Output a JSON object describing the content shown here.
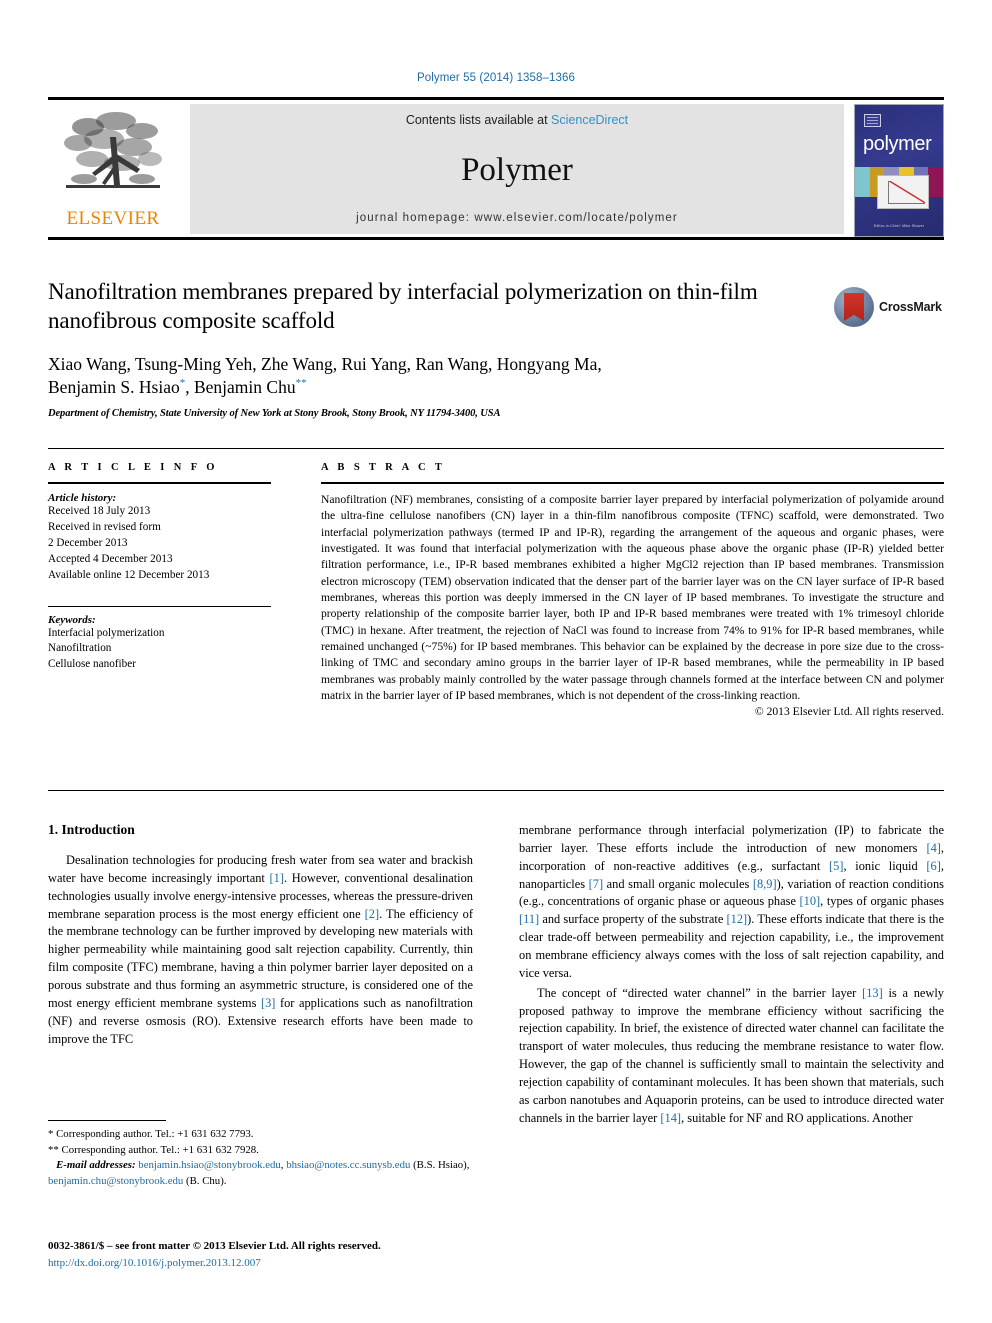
{
  "running_head": "Polymer 55 (2014) 1358–1366",
  "masthead": {
    "publisher_logo_label": "ELSEVIER",
    "contents_prefix": "Contents lists available at ",
    "contents_link": "ScienceDirect",
    "journal_name": "Polymer",
    "homepage": "journal homepage: www.elsevier.com/locate/polymer",
    "cover": {
      "title": "polymer",
      "footer": "Editor-in-Chief: Mike Shaver"
    }
  },
  "article": {
    "title": "Nanofiltration membranes prepared by interfacial polymerization on thin-film nanofibrous composite scaffold",
    "authors_line1": "Xiao Wang, Tsung-Ming Yeh, Zhe Wang, Rui Yang, Ran Wang, Hongyang Ma,",
    "authors_line2_a": "Benjamin S. Hsiao",
    "authors_line2_mark1": "*",
    "authors_line2_b": ", Benjamin Chu",
    "authors_line2_mark2": "**",
    "affiliation": "Department of Chemistry, State University of New York at Stony Brook, Stony Brook, NY 11794-3400, USA",
    "crossmark_label": "CrossMark"
  },
  "article_info": {
    "heading": "A R T I C L E   I N F O",
    "history_label": "Article history:",
    "history": [
      "Received 18 July 2013",
      "Received in revised form",
      "2 December 2013",
      "Accepted 4 December 2013",
      "Available online 12 December 2013"
    ],
    "keywords_label": "Keywords:",
    "keywords": [
      "Interfacial polymerization",
      "Nanofiltration",
      "Cellulose nanofiber"
    ]
  },
  "abstract": {
    "heading": "A B S T R A C T",
    "text": "Nanofiltration (NF) membranes, consisting of a composite barrier layer prepared by interfacial polymerization of polyamide around the ultra-fine cellulose nanofibers (CN) layer in a thin-film nanofibrous composite (TFNC) scaffold, were demonstrated. Two interfacial polymerization pathways (termed IP and IP-R), regarding the arrangement of the aqueous and organic phases, were investigated. It was found that interfacial polymerization with the aqueous phase above the organic phase (IP-R) yielded better filtration performance, i.e., IP-R based membranes exhibited a higher MgCl2 rejection than IP based membranes. Transmission electron microscopy (TEM) observation indicated that the denser part of the barrier layer was on the CN layer surface of IP-R based membranes, whereas this portion was deeply immersed in the CN layer of IP based membranes. To investigate the structure and property relationship of the composite barrier layer, both IP and IP-R based membranes were treated with 1% trimesoyl chloride (TMC) in hexane. After treatment, the rejection of NaCl was found to increase from 74% to 91% for IP-R based membranes, while remained unchanged (~75%) for IP based membranes. This behavior can be explained by the decrease in pore size due to the cross-linking of TMC and secondary amino groups in the barrier layer of IP-R based membranes, while the permeability in IP based membranes was probably mainly controlled by the water passage through channels formed at the interface between CN and polymer matrix in the barrier layer of IP based membranes, which is not dependent of the cross-linking reaction.",
    "copyright": "© 2013 Elsevier Ltd. All rights reserved."
  },
  "introduction": {
    "heading": "1. Introduction",
    "left_para1_a": "Desalination technologies for producing fresh water from sea water and brackish water have become increasingly important ",
    "left_ref1": "[1]",
    "left_para1_b": ". However, conventional desalination technologies usually involve energy-intensive processes, whereas the pressure-driven membrane separation process is the most energy efficient one ",
    "left_ref2": "[2]",
    "left_para1_c": ". The efficiency of the membrane technology can be further improved by developing new materials with higher permeability while maintaining good salt rejection capability. Currently, thin film composite (TFC) membrane, having a thin polymer barrier layer deposited on a porous substrate and thus forming an asymmetric structure, is considered one of the most energy efficient membrane systems ",
    "left_ref3": "[3]",
    "left_para1_d": " for applications such as nanofiltration (NF) and reverse osmosis (RO). Extensive research efforts have been made to improve the TFC",
    "right_para1_a": "membrane performance through interfacial polymerization (IP) to fabricate the barrier layer. These efforts include the introduction of new monomers ",
    "right_ref4": "[4]",
    "right_para1_b": ", incorporation of non-reactive additives (e.g., surfactant ",
    "right_ref5": "[5]",
    "right_para1_c": ", ionic liquid ",
    "right_ref6": "[6]",
    "right_para1_d": ", nanoparticles ",
    "right_ref7": "[7]",
    "right_para1_e": " and small organic molecules ",
    "right_ref89": "[8,9]",
    "right_para1_f": "), variation of reaction conditions (e.g., concentrations of organic phase or aqueous phase ",
    "right_ref10": "[10]",
    "right_para1_g": ", types of organic phases ",
    "right_ref11": "[11]",
    "right_para1_h": " and surface property of the substrate ",
    "right_ref12": "[12]",
    "right_para1_i": "). These efforts indicate that there is the clear trade-off between permeability and rejection capability, i.e., the improvement on membrane efficiency always comes with the loss of salt rejection capability, and vice versa.",
    "right_para2_a": "The concept of “directed water channel” in the barrier layer ",
    "right_ref13": "[13]",
    "right_para2_b": " is a newly proposed pathway to improve the membrane efficiency without sacrificing the rejection capability. In brief, the existence of directed water channel can facilitate the transport of water molecules, thus reducing the membrane resistance to water flow. However, the gap of the channel is sufficiently small to maintain the selectivity and rejection capability of contaminant molecules. It has been shown that materials, such as carbon nanotubes and Aquaporin proteins, can be used to introduce directed water channels in the barrier layer ",
    "right_ref14": "[14]",
    "right_para2_c": ", suitable for NF and RO applications. Another"
  },
  "footnotes": {
    "fn1": "* Corresponding author. Tel.: +1 631 632 7793.",
    "fn2": "** Corresponding author. Tel.: +1 631 632 7928.",
    "email_label": "E-mail addresses:",
    "email1": "benjamin.hsiao@stonybrook.edu",
    "email2": "bhsiao@notes.cc.sunysb.edu",
    "email_owner1": " (B.S. Hsiao), ",
    "email3": "benjamin.chu@stonybrook.edu",
    "email_owner2": " (B. Chu).",
    "issn": "0032-3861/$ – see front matter © 2013 Elsevier Ltd. All rights reserved.",
    "doi": "http://dx.doi.org/10.1016/j.polymer.2013.12.007"
  },
  "colors": {
    "link": "#1b6ca8",
    "sciencedirect": "#2a93d5",
    "elsevier_orange": "#ef8200",
    "band_gray": "#e3e3e3"
  }
}
